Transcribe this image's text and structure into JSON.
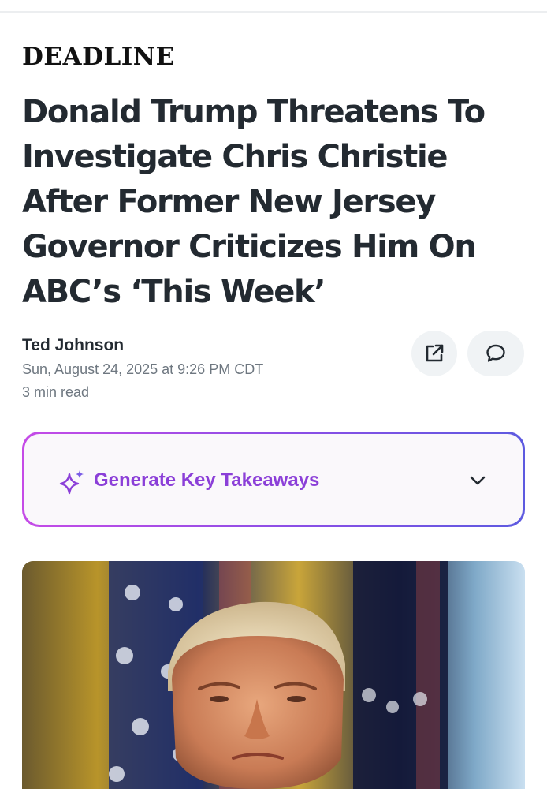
{
  "article": {
    "publisher": "DEADLINE",
    "headline": "Donald Trump Threatens To Investigate Chris Christie After Former New Jersey Governor Criticizes Him On ABC’s ‘This Week’",
    "author": "Ted Johnson",
    "date": "Sun, August 24, 2025 at 9:26 PM CDT",
    "read_time": "3 min read"
  },
  "actions": {
    "share_icon": "share-external-icon",
    "comment_icon": "comment-bubble-icon"
  },
  "takeaways": {
    "label": "Generate Key Takeaways",
    "icon": "sparkle-icon",
    "chevron": "chevron-down-icon"
  },
  "colors": {
    "text": "#232a31",
    "muted": "#6e7780",
    "accent_purple": "#8b3fd8",
    "gradient_start": "#c54be7",
    "gradient_end": "#5d5ae0"
  }
}
